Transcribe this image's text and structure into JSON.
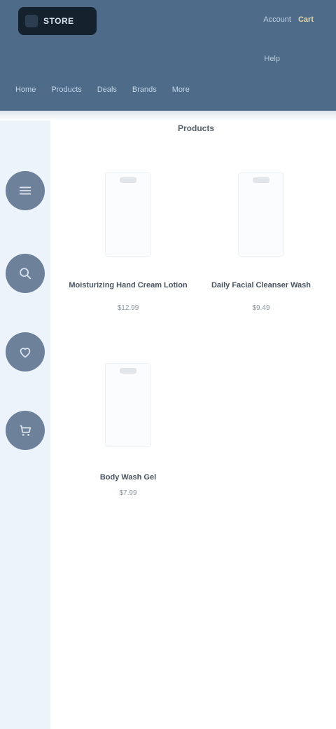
{
  "header": {
    "logo_text": "STORE",
    "links": [
      "Account",
      "Cart"
    ],
    "sub_link": "Help",
    "nav": [
      "Home",
      "Products",
      "Deals",
      "Brands",
      "More"
    ]
  },
  "page": {
    "title": "Products"
  },
  "rail": {
    "items": [
      {
        "icon": "menu-icon"
      },
      {
        "icon": "search-icon"
      },
      {
        "icon": "heart-icon"
      },
      {
        "icon": "cart-icon"
      }
    ]
  },
  "products": [
    {
      "name": "Moisturizing Hand Cream Lotion",
      "price": "$12.99"
    },
    {
      "name": "Daily Facial Cleanser Wash",
      "price": "$9.49"
    },
    {
      "name": "Body Wash Gel",
      "price": "$7.99"
    }
  ],
  "colors": {
    "header_bg": "#4e6b8a",
    "rail_bg": "#edf3fa",
    "rail_button": "#6e819a",
    "logo_bg": "#15212d"
  }
}
